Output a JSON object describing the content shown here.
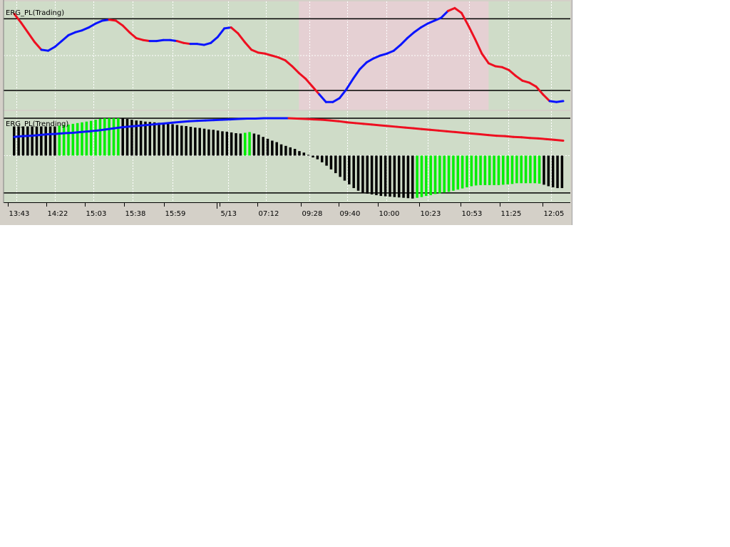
{
  "chart_data": [
    {
      "type": "line",
      "title": "ERG_PL(Trading)",
      "ylim": [
        0,
        1
      ],
      "grid": true,
      "shaded_periods": [
        {
          "from_index": 42,
          "to_index": 70,
          "color": "#e5d0d3"
        },
        {
          "from_index": 86,
          "to_index": 97,
          "color": "#e5d0d3"
        }
      ],
      "levels": [
        0.88,
        0.14
      ],
      "colors": {
        "up": "#0a14ff",
        "down": "#ee0f20"
      },
      "values": [
        0.93,
        0.84,
        0.74,
        0.64,
        0.56,
        0.55,
        0.59,
        0.65,
        0.71,
        0.74,
        0.76,
        0.79,
        0.83,
        0.86,
        0.87,
        0.86,
        0.81,
        0.74,
        0.68,
        0.66,
        0.65,
        0.65,
        0.66,
        0.66,
        0.65,
        0.63,
        0.62,
        0.62,
        0.61,
        0.63,
        0.69,
        0.78,
        0.79,
        0.73,
        0.64,
        0.56,
        0.53,
        0.52,
        0.5,
        0.48,
        0.45,
        0.39,
        0.32,
        0.26,
        0.18,
        0.1,
        0.02,
        0.02,
        0.06,
        0.15,
        0.26,
        0.36,
        0.43,
        0.47,
        0.5,
        0.52,
        0.55,
        0.61,
        0.68,
        0.74,
        0.79,
        0.83,
        0.86,
        0.89,
        0.96,
        0.99,
        0.94,
        0.81,
        0.67,
        0.52,
        0.42,
        0.39,
        0.38,
        0.35,
        0.29,
        0.24,
        0.22,
        0.18,
        0.1,
        0.03,
        0.02,
        0.03
      ],
      "direction": [
        "d",
        "d",
        "d",
        "d",
        "d",
        "u",
        "u",
        "u",
        "u",
        "u",
        "u",
        "u",
        "u",
        "u",
        "u",
        "d",
        "d",
        "d",
        "d",
        "d",
        "d",
        "u",
        "u",
        "u",
        "u",
        "d",
        "d",
        "u",
        "u",
        "u",
        "u",
        "u",
        "u",
        "d",
        "d",
        "d",
        "d",
        "d",
        "d",
        "d",
        "d",
        "d",
        "d",
        "d",
        "d",
        "d",
        "u",
        "u",
        "u",
        "u",
        "u",
        "u",
        "u",
        "u",
        "u",
        "u",
        "u",
        "u",
        "u",
        "u",
        "u",
        "u",
        "u",
        "u",
        "u",
        "d",
        "d",
        "d",
        "d",
        "d",
        "d",
        "d",
        "d",
        "d",
        "d",
        "d",
        "d",
        "d",
        "d",
        "d",
        "u",
        "u"
      ]
    },
    {
      "type": "bar",
      "title": "ERG_PL(Trending)",
      "ylim": [
        -1.25,
        1
      ],
      "levels": [
        1,
        -1
      ],
      "zero_line": true,
      "colors": {
        "rising": "#00f000",
        "falling": "#000000",
        "signal_up": "#0a14ff",
        "signal_down": "#ee0f20"
      },
      "bars": [
        0.78,
        0.78,
        0.78,
        0.78,
        0.78,
        0.78,
        0.78,
        0.78,
        0.78,
        0.78,
        0.8,
        0.82,
        0.83,
        0.85,
        0.87,
        0.89,
        0.91,
        0.93,
        0.96,
        0.98,
        1.0,
        1.0,
        1.0,
        1.0,
        1.0,
        0.98,
        0.96,
        0.94,
        0.93,
        0.91,
        0.9,
        0.89,
        0.88,
        0.86,
        0.85,
        0.84,
        0.82,
        0.8,
        0.79,
        0.77,
        0.75,
        0.74,
        0.72,
        0.7,
        0.69,
        0.67,
        0.65,
        0.64,
        0.62,
        0.6,
        0.59,
        0.61,
        0.63,
        0.59,
        0.56,
        0.5,
        0.45,
        0.4,
        0.36,
        0.3,
        0.26,
        0.22,
        0.18,
        0.12,
        0.08,
        0.02,
        -0.05,
        -0.1,
        -0.18,
        -0.27,
        -0.37,
        -0.47,
        -0.57,
        -0.67,
        -0.77,
        -0.87,
        -0.94,
        -0.99,
        -1.02,
        -1.04,
        -1.06,
        -1.08,
        -1.09,
        -1.1,
        -1.11,
        -1.12,
        -1.13,
        -1.14,
        -1.15,
        -1.13,
        -1.11,
        -1.08,
        -1.06,
        -1.03,
        -1.01,
        -0.99,
        -0.97,
        -0.94,
        -0.91,
        -0.88,
        -0.85,
        -0.82,
        -0.8,
        -0.79,
        -0.79,
        -0.79,
        -0.79,
        -0.79,
        -0.78,
        -0.77,
        -0.76,
        -0.74,
        -0.74,
        -0.74,
        -0.74,
        -0.74,
        -0.75,
        -0.78,
        -0.82,
        -0.85,
        -0.87,
        -0.87
      ],
      "bar_rising": [
        0,
        0,
        0,
        0,
        0,
        0,
        0,
        0,
        0,
        0,
        1,
        1,
        1,
        1,
        1,
        1,
        1,
        1,
        1,
        1,
        1,
        1,
        1,
        1,
        0,
        0,
        0,
        0,
        0,
        0,
        0,
        0,
        0,
        0,
        0,
        0,
        0,
        0,
        0,
        0,
        0,
        0,
        0,
        0,
        0,
        0,
        0,
        0,
        0,
        0,
        0,
        1,
        1,
        0,
        0,
        0,
        0,
        0,
        0,
        0,
        0,
        0,
        0,
        0,
        0,
        0,
        0,
        0,
        0,
        0,
        0,
        0,
        0,
        0,
        0,
        0,
        0,
        0,
        0,
        0,
        0,
        0,
        0,
        0,
        0,
        0,
        0,
        0,
        0,
        1,
        1,
        1,
        1,
        1,
        1,
        1,
        1,
        1,
        1,
        1,
        1,
        1,
        1,
        1,
        1,
        1,
        1,
        1,
        1,
        1,
        1,
        1,
        1,
        1,
        1,
        1,
        1,
        0,
        0,
        0,
        0,
        0
      ],
      "signal": [
        0.5,
        0.52,
        0.53,
        0.55,
        0.57,
        0.58,
        0.6,
        0.61,
        0.63,
        0.65,
        0.67,
        0.7,
        0.73,
        0.76,
        0.78,
        0.8,
        0.82,
        0.84,
        0.86,
        0.88,
        0.9,
        0.92,
        0.93,
        0.94,
        0.95,
        0.96,
        0.97,
        0.98,
        0.99,
        0.99,
        1.0,
        1.0,
        1.0,
        1.0,
        0.99,
        0.98,
        0.97,
        0.96,
        0.94,
        0.92,
        0.89,
        0.87,
        0.85,
        0.83,
        0.81,
        0.79,
        0.77,
        0.75,
        0.73,
        0.71,
        0.69,
        0.67,
        0.65,
        0.63,
        0.61,
        0.59,
        0.57,
        0.55,
        0.53,
        0.52,
        0.5,
        0.49,
        0.47,
        0.46,
        0.44,
        0.42,
        0.4
      ],
      "signal_direction": [
        "u",
        "u",
        "u",
        "u",
        "u",
        "u",
        "u",
        "u",
        "u",
        "u",
        "u",
        "u",
        "u",
        "u",
        "u",
        "u",
        "u",
        "u",
        "u",
        "u",
        "u",
        "u",
        "u",
        "u",
        "u",
        "u",
        "u",
        "u",
        "u",
        "u",
        "u",
        "u",
        "u",
        "u",
        "d",
        "d",
        "d",
        "d",
        "d",
        "d",
        "d",
        "d",
        "d",
        "d",
        "d",
        "d",
        "d",
        "d",
        "d",
        "d",
        "d",
        "d",
        "d",
        "d",
        "d",
        "d",
        "d",
        "d",
        "d",
        "d",
        "d",
        "d",
        "d",
        "d",
        "d",
        "d",
        "d"
      ]
    }
  ],
  "x_axis": {
    "labels": [
      "13:43",
      "14:22",
      "15:03",
      "15:38",
      "15:59",
      "5/13",
      "07:12",
      "09:28",
      "09:40",
      "10:00",
      "10:23",
      "10:53",
      "11:25",
      "12:05"
    ],
    "label_positions": [
      0.007,
      0.075,
      0.144,
      0.213,
      0.283,
      0.381,
      0.448,
      0.524,
      0.591,
      0.661,
      0.733,
      0.806,
      0.876,
      0.951
    ],
    "divider_positions": [
      0.376
    ]
  },
  "colors": {
    "pane_background": "#cfdcc8",
    "window_background": "#d4d0c8",
    "gridline": "#ffffff",
    "level_line": "#000000"
  }
}
